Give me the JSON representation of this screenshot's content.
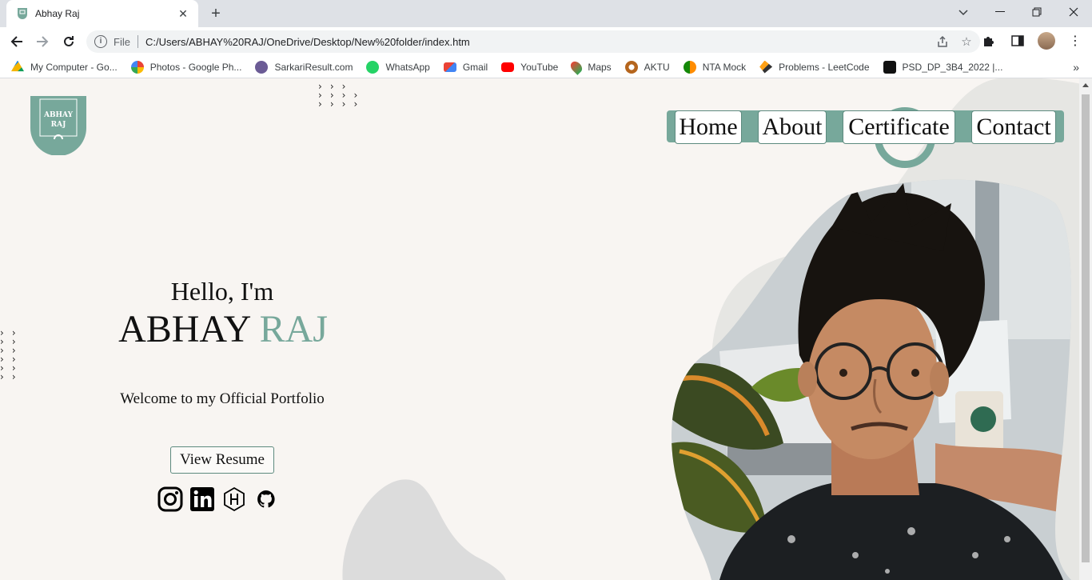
{
  "browser": {
    "tab_title": "Abhay Raj",
    "tab_close": "✕",
    "new_tab": "+",
    "address": {
      "scheme_label": "File",
      "url": "C:/Users/ABHAY%20RAJ/OneDrive/Desktop/New%20folder/index.htm"
    },
    "bookmarks": [
      {
        "label": "My Computer - Go...",
        "icon": "google-drive-icon",
        "color": "#f4b400"
      },
      {
        "label": "Photos - Google Ph...",
        "icon": "google-photos-icon",
        "color": "#ea4335"
      },
      {
        "label": "SarkariResult.com",
        "icon": "sarkari-icon",
        "color": "#6b5b95"
      },
      {
        "label": "WhatsApp",
        "icon": "whatsapp-icon",
        "color": "#25d366"
      },
      {
        "label": "Gmail",
        "icon": "gmail-icon",
        "color": "#ea4335"
      },
      {
        "label": "YouTube",
        "icon": "youtube-icon",
        "color": "#ff0000"
      },
      {
        "label": "Maps",
        "icon": "maps-icon",
        "color": "#34a853"
      },
      {
        "label": "AKTU",
        "icon": "aktu-icon",
        "color": "#b5651d"
      },
      {
        "label": "NTA Mock",
        "icon": "nta-icon",
        "color": "#ff8c00"
      },
      {
        "label": "Problems - LeetCode",
        "icon": "leetcode-icon",
        "color": "#ffa116"
      },
      {
        "label": "PSD_DP_3B4_2022 |...",
        "icon": "notion-icon",
        "color": "#111111"
      }
    ],
    "bookmarks_more": "»"
  },
  "site": {
    "logo": {
      "line1": "ABHAY",
      "line2": "RAJ"
    },
    "nav": {
      "home": "Home",
      "about": "About",
      "certificate": "Certificate",
      "contact": "Contact"
    },
    "hero": {
      "greeting": "Hello, I'm",
      "first_name": "ABHAY",
      "last_name": "RAJ",
      "tagline": "Welcome to my Official Portfolio",
      "resume_label": "View Resume"
    },
    "socials": [
      "instagram-icon",
      "linkedin-icon",
      "hashnode-icon",
      "github-icon"
    ],
    "colors": {
      "accent": "#77a89b",
      "background": "#f8f5f2",
      "blob": "#e6e6e3"
    }
  }
}
